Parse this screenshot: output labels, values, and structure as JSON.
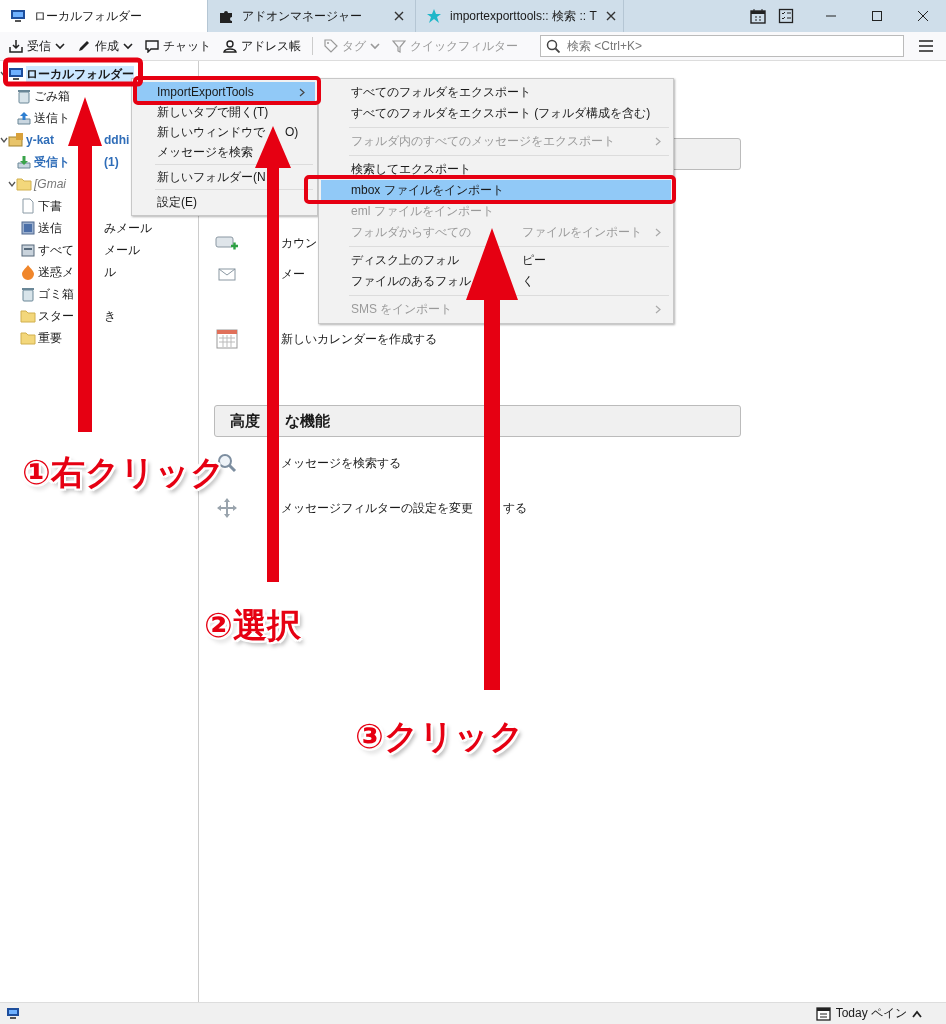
{
  "tabs": [
    {
      "label": "ローカルフォルダー",
      "kind": "folder",
      "selected": true,
      "closable": false
    },
    {
      "label": "アドオンマネージャー",
      "kind": "addon",
      "selected": false,
      "closable": true
    },
    {
      "label": "importexporttools:: 検索 :: T",
      "kind": "web",
      "selected": false,
      "closable": true
    }
  ],
  "toolbar": {
    "buttons": [
      {
        "label": "受信",
        "kind": "get",
        "dropdown": true,
        "disabled": false
      },
      {
        "label": "作成",
        "kind": "write",
        "dropdown": true,
        "disabled": false
      },
      {
        "label": "チャット",
        "kind": "chat",
        "dropdown": false,
        "disabled": false
      },
      {
        "label": "アドレス帳",
        "kind": "contacts",
        "dropdown": false,
        "disabled": false
      },
      {
        "label": "タグ",
        "kind": "tag",
        "dropdown": true,
        "disabled": true
      },
      {
        "label": "クイックフィルター",
        "kind": "filter",
        "dropdown": false,
        "disabled": true
      }
    ],
    "search": {
      "placeholder": "検索 <Ctrl+K>"
    }
  },
  "folder_tree": [
    {
      "label": "ローカルフォルダー",
      "kind": "computer",
      "selected": true,
      "expanded": true,
      "children": [
        {
          "label": "ごみ箱",
          "kind": "trash",
          "selected": false
        },
        {
          "label": "送信ト",
          "kind": "outbox",
          "selected": false
        }
      ]
    },
    {
      "label": "y-kat",
      "tail": "ddhi",
      "kind": "account",
      "selected": false,
      "expanded": true,
      "children": [
        {
          "label": "受信ト",
          "count": "(1)",
          "kind": "inbox",
          "selected": false
        },
        {
          "label": "[Gmai",
          "kind": "virtual",
          "selected": false,
          "expanded": true,
          "children": [
            {
              "label": "下書",
              "kind": "draft",
              "selected": false
            },
            {
              "label": "送信",
              "tail": "みメール",
              "kind": "sent",
              "selected": false
            },
            {
              "label": "すべて",
              "tail": "メール",
              "kind": "archive",
              "selected": false
            },
            {
              "label": "迷惑メ",
              "tail": "ル",
              "kind": "junk",
              "selected": false
            },
            {
              "label": "ゴミ箱",
              "kind": "trash",
              "selected": false
            },
            {
              "label": "スター",
              "tail": "き",
              "kind": "folder",
              "selected": false
            },
            {
              "label": "重要",
              "kind": "folder",
              "selected": false
            }
          ]
        }
      ]
    }
  ],
  "context_menu": {
    "items": [
      {
        "kind": "item",
        "label": "ImportExportTools",
        "submenu": true,
        "selected": true,
        "disabled": false
      },
      {
        "kind": "item",
        "label": "新しいタブで開く(T)",
        "submenu": false,
        "selected": false,
        "disabled": false
      },
      {
        "kind": "item",
        "label": "新しいウィンドウで",
        "tail": "O)",
        "submenu": false,
        "selected": false,
        "disabled": false
      },
      {
        "kind": "item",
        "label": "メッセージを検索",
        "submenu": false,
        "selected": false,
        "disabled": false
      },
      {
        "kind": "separator"
      },
      {
        "kind": "item",
        "label": "新しいフォルダー(N",
        "submenu": false,
        "selected": false,
        "disabled": false
      },
      {
        "kind": "separator"
      },
      {
        "kind": "item",
        "label": "設定(E)",
        "submenu": false,
        "selected": false,
        "disabled": false
      }
    ]
  },
  "submenu": {
    "items": [
      {
        "kind": "item",
        "label": "すべてのフォルダをエクスポート",
        "submenu": false,
        "selected": false,
        "disabled": false
      },
      {
        "kind": "item",
        "label": "すべてのフォルダをエクスポート (フォルダ構成を含む)",
        "submenu": false,
        "selected": false,
        "disabled": false
      },
      {
        "kind": "separator"
      },
      {
        "kind": "item",
        "label": "フォルダ内のすべてのメッセージをエクスポート",
        "submenu": true,
        "selected": false,
        "disabled": true
      },
      {
        "kind": "separator"
      },
      {
        "kind": "item",
        "label": "検索してエクスポート",
        "submenu": false,
        "selected": false,
        "disabled": false
      },
      {
        "kind": "item",
        "label": "mbox ファイルをインポート",
        "submenu": false,
        "selected": true,
        "disabled": false
      },
      {
        "kind": "item",
        "label": "eml ファイルをインポート",
        "submenu": false,
        "selected": false,
        "disabled": true
      },
      {
        "kind": "item",
        "label": "フォルダからすべての",
        "tail": "ファイルをインポート",
        "submenu": true,
        "selected": false,
        "disabled": true
      },
      {
        "kind": "separator"
      },
      {
        "kind": "item",
        "label": "ディスク上のフォル",
        "tail": "ピー",
        "submenu": false,
        "selected": false,
        "disabled": false
      },
      {
        "kind": "item",
        "label": "ファイルのあるフォル",
        "tail": "く",
        "submenu": false,
        "selected": false,
        "disabled": false
      },
      {
        "kind": "separator"
      },
      {
        "kind": "item",
        "label": "SMS をインポート",
        "submenu": true,
        "selected": false,
        "disabled": true
      }
    ]
  },
  "start_page": {
    "items": [
      {
        "kind": "account",
        "label": "カウン"
      },
      {
        "kind": "mail",
        "label": "メー"
      },
      {
        "kind": "calendar",
        "label": "新しいカレンダーを作成する"
      }
    ],
    "advanced": {
      "title": "高度",
      "title_tail": "な機能",
      "items": [
        {
          "kind": "search",
          "label": "メッセージを検索する"
        },
        {
          "kind": "filter",
          "label": "メッセージフィルターの設定を変更",
          "tail": "する"
        }
      ]
    }
  },
  "annotations": {
    "steps": [
      {
        "label": "①右クリック"
      },
      {
        "label": "②選択"
      },
      {
        "label": "③クリック"
      }
    ]
  },
  "status_bar": {
    "today_pane": "Today ペイン"
  }
}
